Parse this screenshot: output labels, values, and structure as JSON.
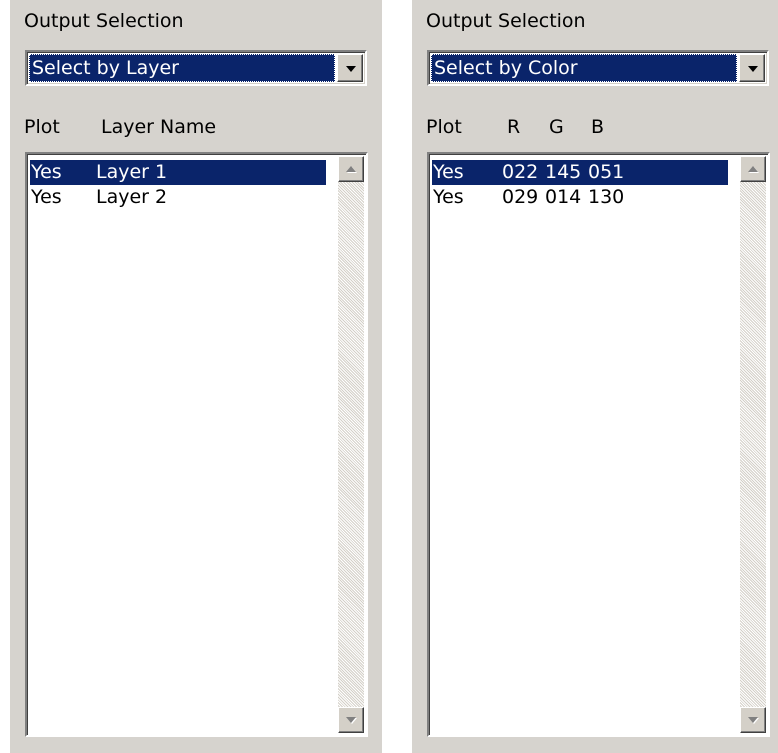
{
  "colors": {
    "panel_bg": "#d6d3ce",
    "selection_bg": "#0a246a",
    "selection_fg": "#ffffff"
  },
  "left_panel": {
    "section_label": "Output Selection",
    "combo_value": "Select by Layer",
    "headers": {
      "plot": "Plot",
      "name": "Layer Name"
    },
    "rows": [
      {
        "plot": "Yes",
        "name": "Layer 1",
        "selected": true
      },
      {
        "plot": "Yes",
        "name": "Layer 2",
        "selected": false
      }
    ]
  },
  "right_panel": {
    "section_label": "Output Selection",
    "combo_value": "Select by Color",
    "headers": {
      "plot": "Plot",
      "r": "R",
      "g": "G",
      "b": "B"
    },
    "rows": [
      {
        "plot": "Yes",
        "r": "022",
        "g": "145",
        "b": "051",
        "selected": true
      },
      {
        "plot": "Yes",
        "r": "029",
        "g": "014",
        "b": "130",
        "selected": false
      }
    ]
  },
  "icons": {
    "combo_arrow": "chevron-down-icon",
    "scroll_up": "scroll-up-arrow-icon",
    "scroll_down": "scroll-down-arrow-icon"
  }
}
